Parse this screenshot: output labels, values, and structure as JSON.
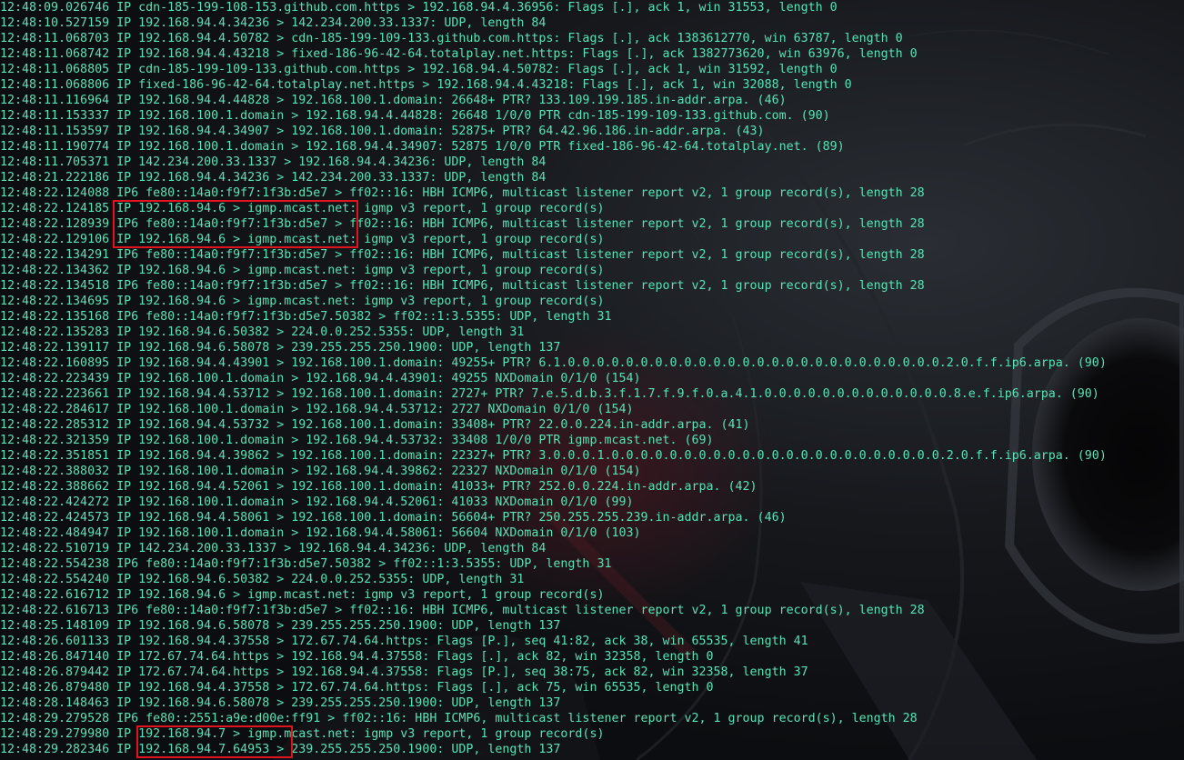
{
  "colors": {
    "text": "#5ee0b4",
    "background": "#0e0f12",
    "highlight": "#e0141e"
  },
  "log_lines": [
    "12:48:09.026746 IP cdn-185-199-108-153.github.com.https > 192.168.94.4.36956: Flags [.], ack 1, win 31553, length 0",
    "12:48:10.527159 IP 192.168.94.4.34236 > 142.234.200.33.1337: UDP, length 84",
    "12:48:11.068703 IP 192.168.94.4.50782 > cdn-185-199-109-133.github.com.https: Flags [.], ack 1383612770, win 63787, length 0",
    "12:48:11.068742 IP 192.168.94.4.43218 > fixed-186-96-42-64.totalplay.net.https: Flags [.], ack 1382773620, win 63976, length 0",
    "12:48:11.068805 IP cdn-185-199-109-133.github.com.https > 192.168.94.4.50782: Flags [.], ack 1, win 31592, length 0",
    "12:48:11.068806 IP fixed-186-96-42-64.totalplay.net.https > 192.168.94.4.43218: Flags [.], ack 1, win 32088, length 0",
    "12:48:11.116964 IP 192.168.94.4.44828 > 192.168.100.1.domain: 26648+ PTR? 133.109.199.185.in-addr.arpa. (46)",
    "12:48:11.153337 IP 192.168.100.1.domain > 192.168.94.4.44828: 26648 1/0/0 PTR cdn-185-199-109-133.github.com. (90)",
    "12:48:11.153597 IP 192.168.94.4.34907 > 192.168.100.1.domain: 52875+ PTR? 64.42.96.186.in-addr.arpa. (43)",
    "12:48:11.190774 IP 192.168.100.1.domain > 192.168.94.4.34907: 52875 1/0/0 PTR fixed-186-96-42-64.totalplay.net. (89)",
    "12:48:11.705371 IP 142.234.200.33.1337 > 192.168.94.4.34236: UDP, length 84",
    "12:48:21.222186 IP 192.168.94.4.34236 > 142.234.200.33.1337: UDP, length 84",
    "12:48:22.124088 IP6 fe80::14a0:f9f7:1f3b:d5e7 > ff02::16: HBH ICMP6, multicast listener report v2, 1 group record(s), length 28",
    "12:48:22.124185 IP 192.168.94.6 > igmp.mcast.net: igmp v3 report, 1 group record(s)",
    "12:48:22.128939 IP6 fe80::14a0:f9f7:1f3b:d5e7 > ff02::16: HBH ICMP6, multicast listener report v2, 1 group record(s), length 28",
    "12:48:22.129106 IP 192.168.94.6 > igmp.mcast.net: igmp v3 report, 1 group record(s)",
    "12:48:22.134291 IP6 fe80::14a0:f9f7:1f3b:d5e7 > ff02::16: HBH ICMP6, multicast listener report v2, 1 group record(s), length 28",
    "12:48:22.134362 IP 192.168.94.6 > igmp.mcast.net: igmp v3 report, 1 group record(s)",
    "12:48:22.134518 IP6 fe80::14a0:f9f7:1f3b:d5e7 > ff02::16: HBH ICMP6, multicast listener report v2, 1 group record(s), length 28",
    "12:48:22.134695 IP 192.168.94.6 > igmp.mcast.net: igmp v3 report, 1 group record(s)",
    "12:48:22.135168 IP6 fe80::14a0:f9f7:1f3b:d5e7.50382 > ff02::1:3.5355: UDP, length 31",
    "12:48:22.135283 IP 192.168.94.6.50382 > 224.0.0.252.5355: UDP, length 31",
    "12:48:22.139117 IP 192.168.94.6.58078 > 239.255.255.250.1900: UDP, length 137",
    "12:48:22.160895 IP 192.168.94.4.43901 > 192.168.100.1.domain: 49255+ PTR? 6.1.0.0.0.0.0.0.0.0.0.0.0.0.0.0.0.0.0.0.0.0.0.0.0.0.0.0.2.0.f.f.ip6.arpa. (90)",
    "12:48:22.223439 IP 192.168.100.1.domain > 192.168.94.4.43901: 49255 NXDomain 0/1/0 (154)",
    "12:48:22.223661 IP 192.168.94.4.53712 > 192.168.100.1.domain: 2727+ PTR? 7.e.5.d.b.3.f.1.7.f.9.f.0.a.4.1.0.0.0.0.0.0.0.0.0.0.0.0.0.8.e.f.ip6.arpa. (90)",
    "12:48:22.284617 IP 192.168.100.1.domain > 192.168.94.4.53712: 2727 NXDomain 0/1/0 (154)",
    "12:48:22.285312 IP 192.168.94.4.53732 > 192.168.100.1.domain: 33408+ PTR? 22.0.0.224.in-addr.arpa. (41)",
    "12:48:22.321359 IP 192.168.100.1.domain > 192.168.94.4.53732: 33408 1/0/0 PTR igmp.mcast.net. (69)",
    "12:48:22.351851 IP 192.168.94.4.39862 > 192.168.100.1.domain: 22327+ PTR? 3.0.0.0.1.0.0.0.0.0.0.0.0.0.0.0.0.0.0.0.0.0.0.0.0.0.0.0.2.0.f.f.ip6.arpa. (90)",
    "12:48:22.388032 IP 192.168.100.1.domain > 192.168.94.4.39862: 22327 NXDomain 0/1/0 (154)",
    "12:48:22.388662 IP 192.168.94.4.52061 > 192.168.100.1.domain: 41033+ PTR? 252.0.0.224.in-addr.arpa. (42)",
    "12:48:22.424272 IP 192.168.100.1.domain > 192.168.94.4.52061: 41033 NXDomain 0/1/0 (99)",
    "12:48:22.424573 IP 192.168.94.4.58061 > 192.168.100.1.domain: 56604+ PTR? 250.255.255.239.in-addr.arpa. (46)",
    "12:48:22.484947 IP 192.168.100.1.domain > 192.168.94.4.58061: 56604 NXDomain 0/1/0 (103)",
    "12:48:22.510719 IP 142.234.200.33.1337 > 192.168.94.4.34236: UDP, length 84",
    "12:48:22.554238 IP6 fe80::14a0:f9f7:1f3b:d5e7.50382 > ff02::1:3.5355: UDP, length 31",
    "12:48:22.554240 IP 192.168.94.6.50382 > 224.0.0.252.5355: UDP, length 31",
    "12:48:22.616712 IP 192.168.94.6 > igmp.mcast.net: igmp v3 report, 1 group record(s)",
    "12:48:22.616713 IP6 fe80::14a0:f9f7:1f3b:d5e7 > ff02::16: HBH ICMP6, multicast listener report v2, 1 group record(s), length 28",
    "12:48:25.148109 IP 192.168.94.6.58078 > 239.255.255.250.1900: UDP, length 137",
    "12:48:26.601133 IP 192.168.94.4.37558 > 172.67.74.64.https: Flags [P.], seq 41:82, ack 38, win 65535, length 41",
    "12:48:26.847140 IP 172.67.74.64.https > 192.168.94.4.37558: Flags [.], ack 82, win 32358, length 0",
    "12:48:26.879442 IP 172.67.74.64.https > 192.168.94.4.37558: Flags [P.], seq 38:75, ack 82, win 32358, length 37",
    "12:48:26.879480 IP 192.168.94.4.37558 > 172.67.74.64.https: Flags [.], ack 75, win 65535, length 0",
    "12:48:28.148463 IP 192.168.94.6.58078 > 239.255.255.250.1900: UDP, length 137",
    "12:48:29.279528 IP6 fe80::2551:a9e:d00e:ff91 > ff02::16: HBH ICMP6, multicast listener report v2, 1 group record(s), length 28",
    "12:48:29.279980 IP 192.168.94.7 > igmp.mcast.net: igmp v3 report, 1 group record(s)",
    "12:48:29.282346 IP 192.168.94.7.64953 > 239.255.255.250.1900: UDP, length 137"
  ]
}
